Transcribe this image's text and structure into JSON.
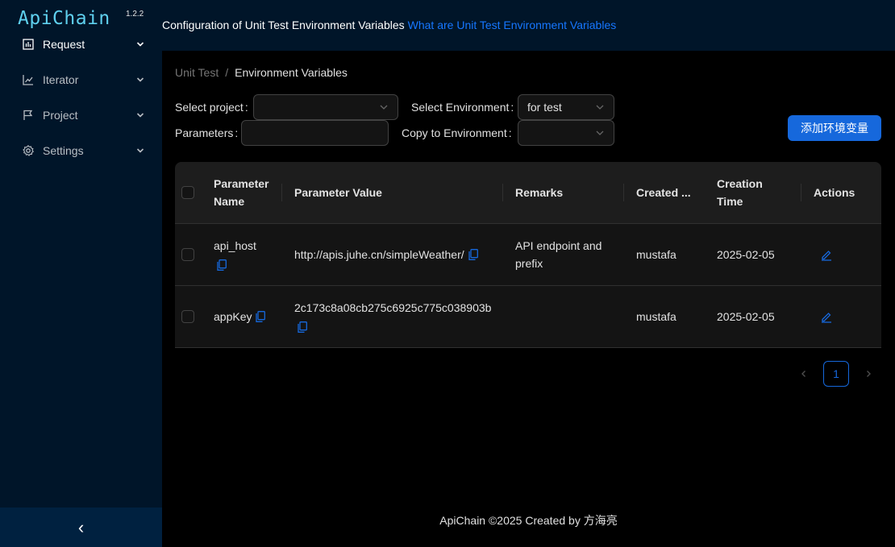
{
  "app": {
    "logo": "ApiChain",
    "version": "1.2.2"
  },
  "sidebar": {
    "items": [
      {
        "label": "Request",
        "icon": "bar-chart-icon"
      },
      {
        "label": "Iterator",
        "icon": "line-chart-icon"
      },
      {
        "label": "Project",
        "icon": "flag-icon"
      },
      {
        "label": "Settings",
        "icon": "gear-icon"
      }
    ],
    "collapse_glyph": "‹"
  },
  "header": {
    "title": "Configuration of Unit Test Environment Variables",
    "link": "What are Unit Test Environment Variables"
  },
  "breadcrumb": {
    "parent": "Unit Test",
    "separator": "/",
    "current": "Environment Variables"
  },
  "filters": {
    "project_label": "Select project",
    "project_value": "",
    "environment_label": "Select Environment",
    "environment_value": "for test",
    "parameters_label": "Parameters",
    "parameters_value": "",
    "copy_label": "Copy to Environment",
    "copy_value": "",
    "colon": ":"
  },
  "add_button": "添加环境变量",
  "table": {
    "headers": {
      "name_l1": "Parameter",
      "name_l2": "Name",
      "value": "Parameter Value",
      "remarks": "Remarks",
      "created_by": "Created ...",
      "time_l1": "Creation",
      "time_l2": "Time",
      "actions": "Actions"
    },
    "rows": [
      {
        "name": "api_host",
        "value": "http://apis.juhe.cn/simpleWeather/",
        "remarks": "API endpoint and prefix",
        "created_by": "mustafa",
        "time": "2025-02-05"
      },
      {
        "name": "appKey",
        "value": "2c173c8a08cb275c6925c775c038903b",
        "remarks": "",
        "created_by": "mustafa",
        "time": "2025-02-05"
      }
    ]
  },
  "pagination": {
    "current": "1"
  },
  "footer": "ApiChain ©2025 Created by 方海亮",
  "colors": {
    "sidebar": "#001529",
    "accent": "#1668dc",
    "link": "#1677ff",
    "logo": "#5fd0ee"
  }
}
